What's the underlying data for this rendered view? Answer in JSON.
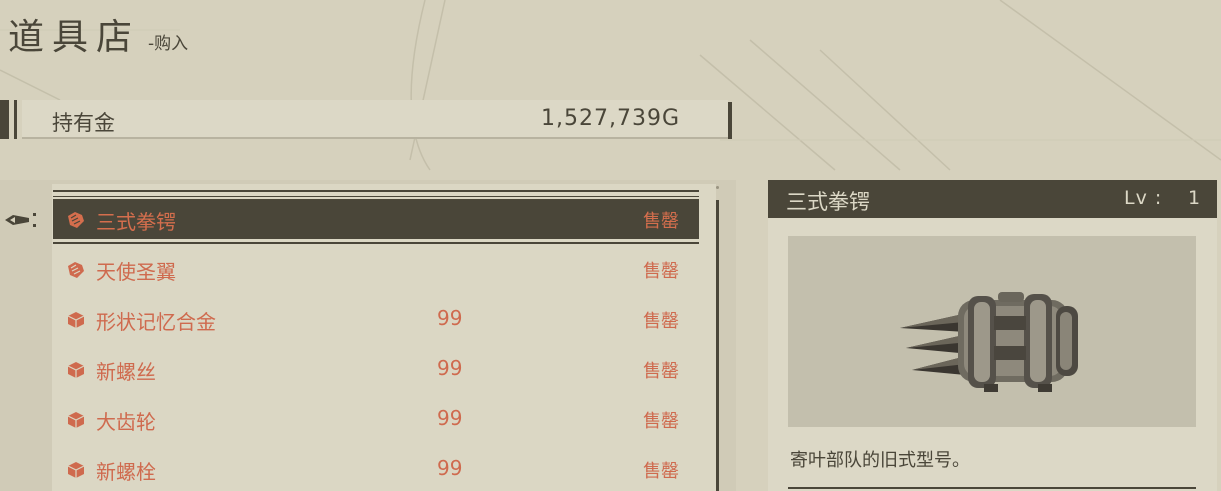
{
  "header": {
    "title": "道具店",
    "subtitle": "-购入"
  },
  "money": {
    "label": "持有金",
    "value": "1,527,739G"
  },
  "items": [
    {
      "name": "三式拳锷",
      "qty": "",
      "status": "售罄",
      "icon": "weapon-icon",
      "selected": true
    },
    {
      "name": "天使圣翼",
      "qty": "",
      "status": "售罄",
      "icon": "weapon-icon",
      "selected": false
    },
    {
      "name": "形状记忆合金",
      "qty": "99",
      "status": "售罄",
      "icon": "material-cube-icon",
      "selected": false
    },
    {
      "name": "新螺丝",
      "qty": "99",
      "status": "售罄",
      "icon": "material-cube-icon",
      "selected": false
    },
    {
      "name": "大齿轮",
      "qty": "99",
      "status": "售罄",
      "icon": "material-cube-icon",
      "selected": false
    },
    {
      "name": "新螺栓",
      "qty": "99",
      "status": "售罄",
      "icon": "material-cube-icon",
      "selected": false
    }
  ],
  "detail": {
    "name": "三式拳锷",
    "lv_label": "Lv :",
    "lv_value": "1",
    "description": "寄叶部队的旧式型号。"
  },
  "colors": {
    "background": "#d6d1bd",
    "dark": "#4a4639",
    "accent": "#cf6a4e"
  }
}
